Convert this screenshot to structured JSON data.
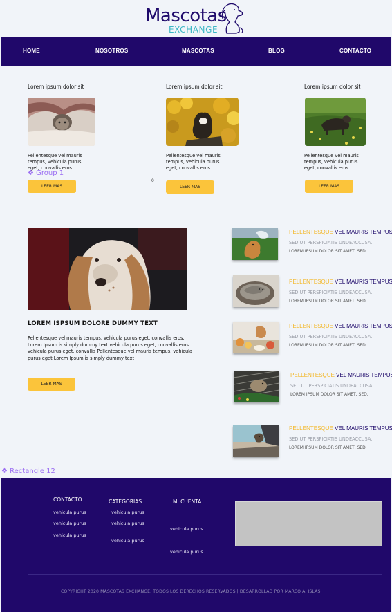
{
  "brand": {
    "name": "Mascotas",
    "tagline": "EXCHANGE"
  },
  "nav": {
    "items": [
      {
        "label": "HOME"
      },
      {
        "label": "NOSOTROS"
      },
      {
        "label": "MASCOTAS"
      },
      {
        "label": "BLOG"
      },
      {
        "label": "CONTACTO"
      }
    ]
  },
  "cards": [
    {
      "title": "Lorem ipsum dolor sit",
      "image": "cat-under-blanket",
      "text": "Pellentesque vel mauris tempus, vehicula purus eget, convallis eros.",
      "button": "LEER MAS"
    },
    {
      "title": "Lorem ipsum dolor sit",
      "image": "cat-yellow-flowers",
      "text": "Pellentesque vel mauris tempus, vehicula purus eget, convallis eros.",
      "button": "LEER MAS"
    },
    {
      "title": "Lorem ipsum dolor sit",
      "image": "dog-in-grass",
      "text": "Pellentesque vel mauris tempus, vehicula purus eget, convallis eros.",
      "button": "LEER MAS"
    }
  ],
  "annotations": {
    "group": "Group 1",
    "rectangle": "Rectangle 12",
    "counter": "0"
  },
  "feature": {
    "image": "spaniel-portrait",
    "title": "LOREM ISPSUM DOLORE  DUMMY TEXT",
    "text": "Pellentesque vel mauris tempus, vehicula purus eget, convallis eros. Lorem Ipsum is simply dummy text vehicula purus eget, convallis eros. vehicula purus eget, convallis Pellentesque vel mauris tempus, vehicula purus eget Lorem Ipsum is simply dummy text",
    "button": "LEER MAS"
  },
  "posts": [
    {
      "image": "dog-splash",
      "highlight": "PELLENTESQUE",
      "rest": " VEL MAURIS TEMPUS",
      "sub1": "SED UT PERSPICIATIS UNDEACCUSA.",
      "sub2": "LOREM IPSUM DOLOR SIT AMET,  SED."
    },
    {
      "image": "cat-in-basket",
      "highlight": "PELLENTESQUE",
      "rest": " VEL MAURIS TEMPUS",
      "sub1": "SED UT PERSPICIATIS UNDEACCUSA.",
      "sub2": "LOREM IPSUM DOLOR SIT AMET,  SED."
    },
    {
      "image": "dog-with-food",
      "highlight": "PELLENTESQUE",
      "rest": " VEL MAURIS TEMPUS",
      "sub1": "SED UT PERSPICIATIS UNDEACCUSA.",
      "sub2": "LOREM IPSUM DOLOR SIT AMET,  SED."
    },
    {
      "image": "hamster-in-cage",
      "highlight": "PELLENTESQUE",
      "rest": " VEL MAURIS TEMPUS",
      "sub1": "SED UT PERSPICIATIS UNDEACCUSA.",
      "sub2": "LOREM IPSUM DOLOR SIT AMET,  SED."
    },
    {
      "image": "dog-in-car",
      "highlight": "PELLENTESQUE",
      "rest": " VEL MAURIS TEMPUS",
      "sub1": "SED UT PERSPICIATIS UNDEACCUSA.",
      "sub2": "LOREM IPSUM DOLOR SIT AMET,  SED."
    }
  ],
  "footer": {
    "contacto": {
      "heading": "CONTACTO",
      "links": [
        "vehicula purus",
        "vehicula purus",
        "vehicula purus"
      ]
    },
    "categorias": {
      "heading": "CATEGORIAS",
      "links": [
        "vehicula purus",
        "vehicula purus",
        "vehicula purus"
      ]
    },
    "cuenta": {
      "heading": "MI CUENTA",
      "links": [
        "vehicula purus",
        "vehicula purus"
      ]
    },
    "copyright": "COPYRIGHT 2020 MASCOTAS EXCHANGE. TODOS LOS DERECHOS RESERVADOS | DESARROLLAD POR MARCO A. ISLAS"
  },
  "colors": {
    "primary": "#20086a",
    "accent": "#fbc43b",
    "teal": "#3bb6c4"
  }
}
